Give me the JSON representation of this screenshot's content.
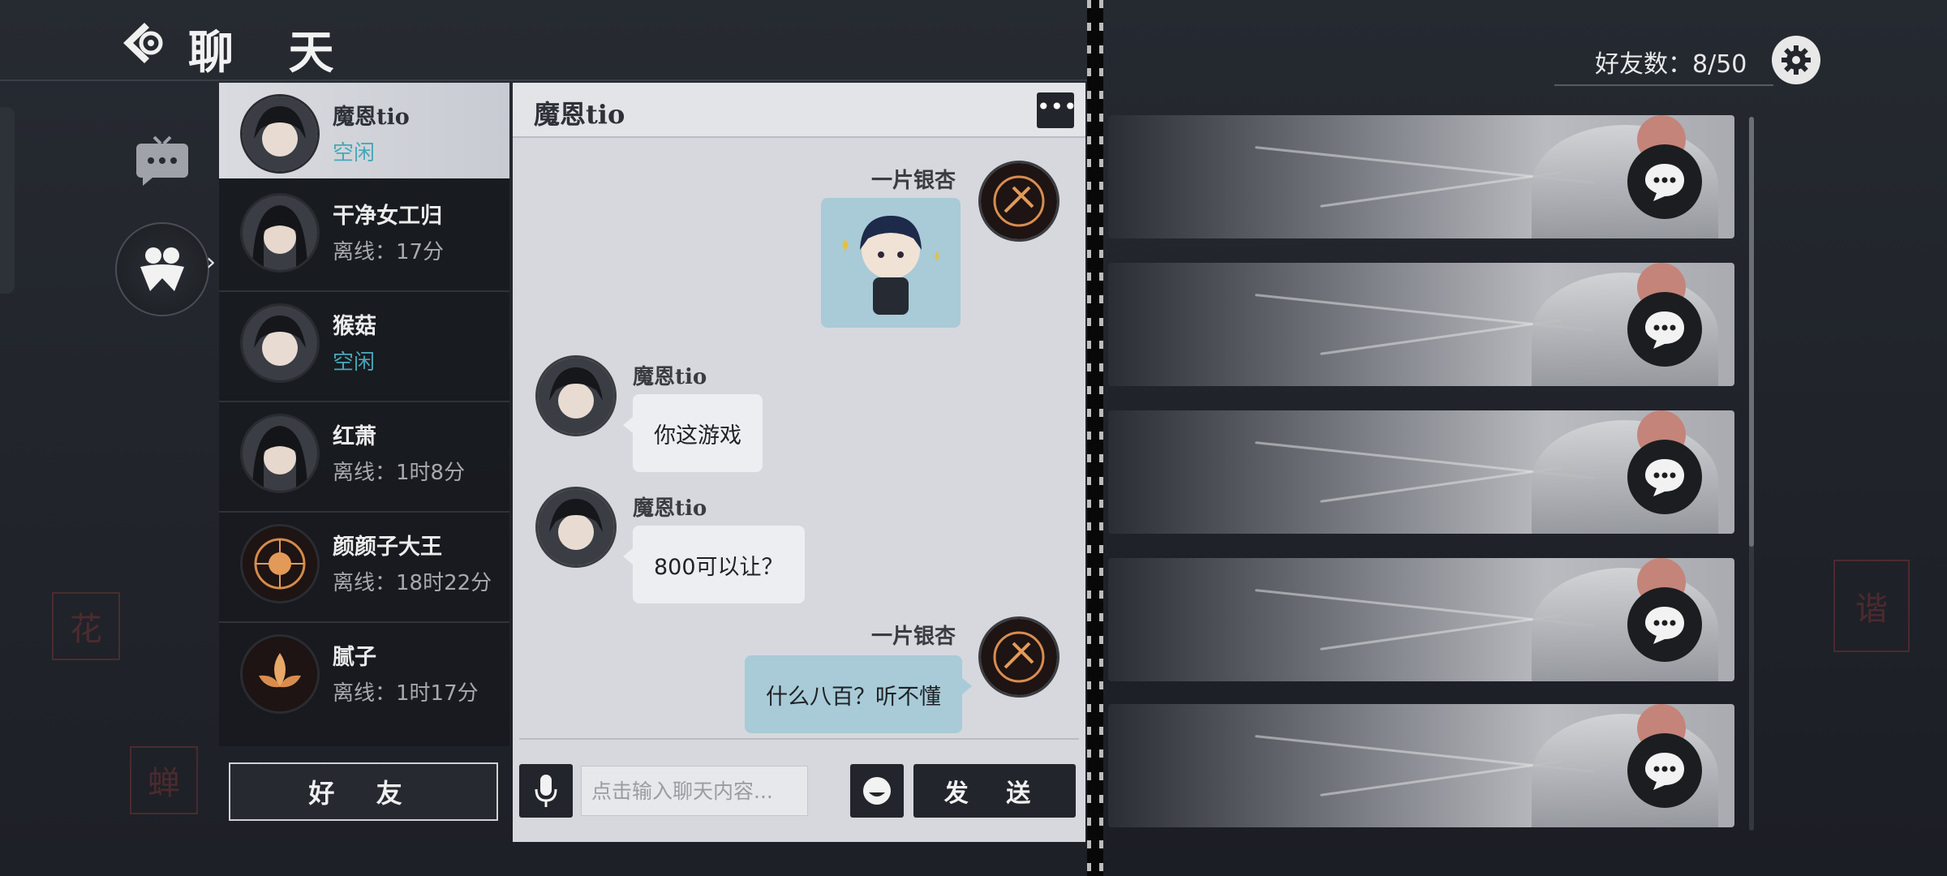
{
  "header": {
    "title": "聊 天",
    "back_icon": "back-arrow-icon"
  },
  "nav": {
    "tabs": [
      {
        "icon": "chat-tv-icon",
        "active": false
      },
      {
        "icon": "friends-icon",
        "active": true
      }
    ]
  },
  "friends": [
    {
      "name": "魔恩tio",
      "status": "空闲",
      "idle": true,
      "selected": true,
      "avatar": "dark-hair-portrait"
    },
    {
      "name": "干净女工归",
      "status": "离线：17分",
      "idle": false,
      "selected": false,
      "avatar": "dark-hair-portrait"
    },
    {
      "name": "猴菇",
      "status": "空闲",
      "idle": true,
      "selected": false,
      "avatar": "dark-hair-portrait"
    },
    {
      "name": "红萧",
      "status": "离线：1时8分",
      "idle": false,
      "selected": false,
      "avatar": "dark-hair-portrait"
    },
    {
      "name": "颜颜子大王",
      "status": "离线：18时22分",
      "idle": false,
      "selected": false,
      "avatar": "glowing-emblem"
    },
    {
      "name": "腻子",
      "status": "离线：1时17分",
      "idle": false,
      "selected": false,
      "avatar": "glowing-lotus"
    }
  ],
  "friends_button": "好 友",
  "chat": {
    "title": "魔恩tio",
    "messages": [
      {
        "sender": "一片银杏",
        "direction": "out",
        "type": "sticker",
        "text": ""
      },
      {
        "sender": "魔恩tio",
        "direction": "in",
        "type": "text",
        "text": "你这游戏"
      },
      {
        "sender": "魔恩tio",
        "direction": "in",
        "type": "text",
        "text": "800可以让？"
      },
      {
        "sender": "一片银杏",
        "direction": "out",
        "type": "text",
        "text": "什么八百？听不懂"
      }
    ],
    "input_placeholder": "点击输入聊天内容...",
    "send_label": "发 送"
  },
  "friend_count_text": "好友数：8/50",
  "cards_count": 5,
  "colors": {
    "idle_status": "#47a7b7",
    "outgoing_bubble": "#a8cbd7",
    "incoming_bubble": "#eceef2",
    "panel_bg": "#d6d8de"
  }
}
